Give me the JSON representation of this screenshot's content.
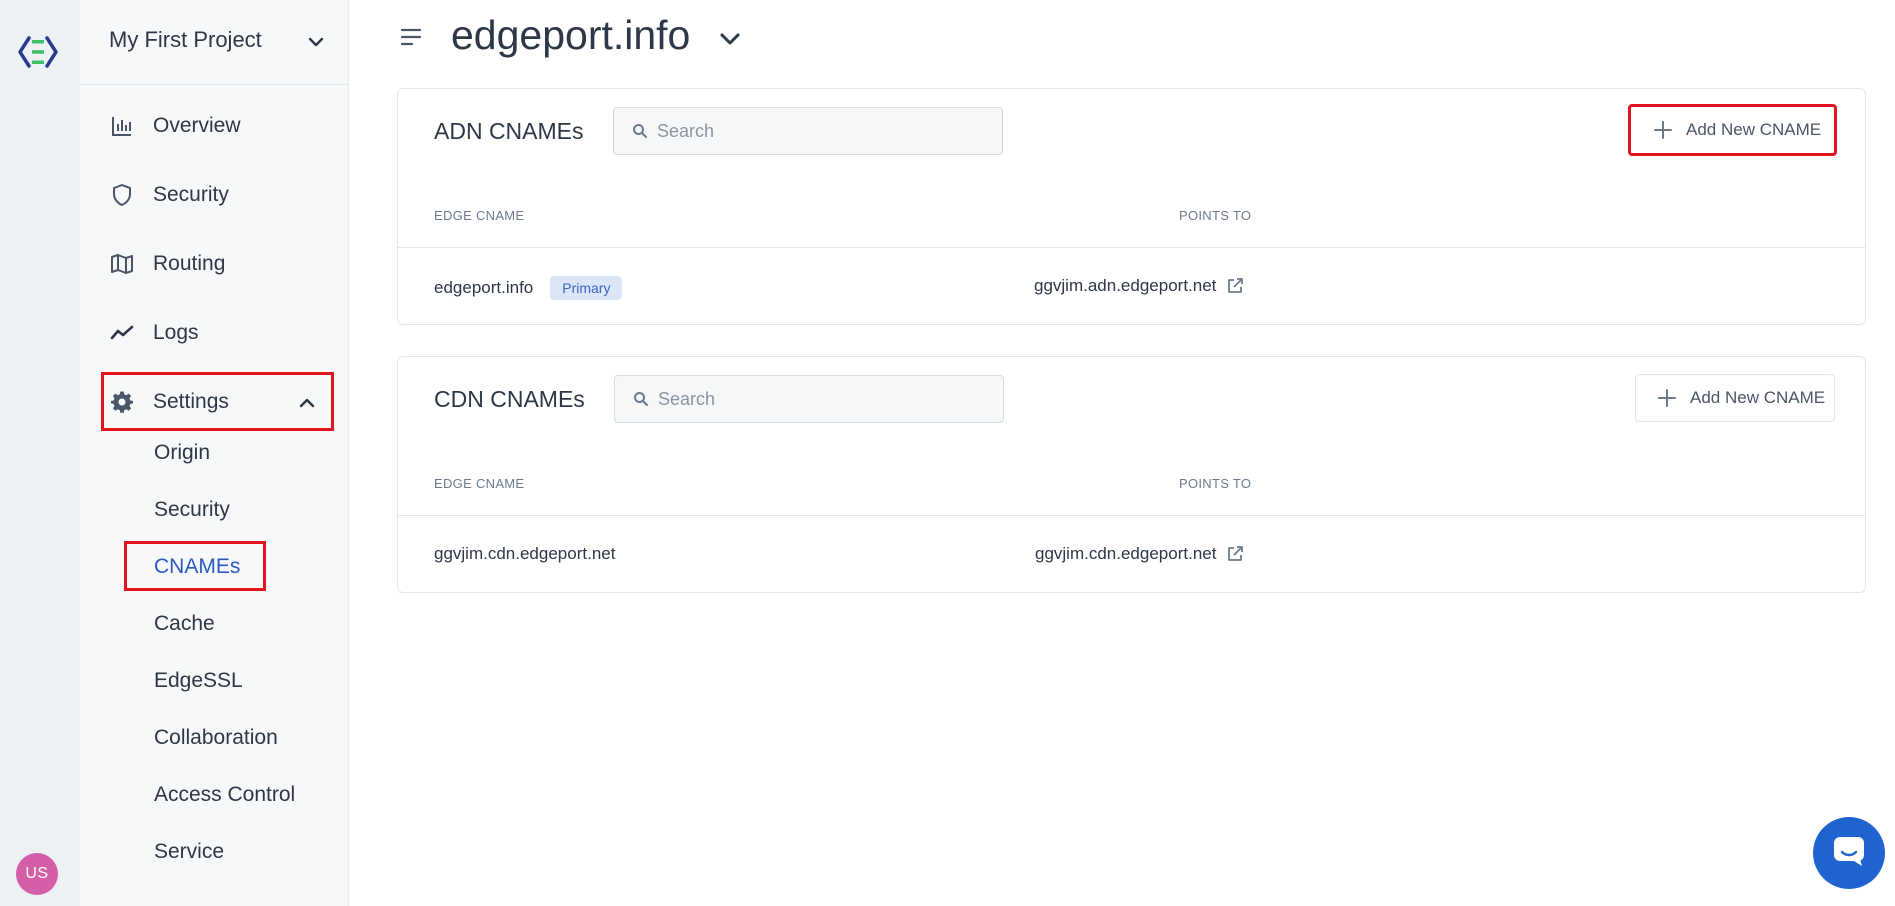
{
  "brand": {
    "logo_icon": "edgeport-logo-icon",
    "accent": "#2b59c3",
    "highlight": "#e3141f"
  },
  "user": {
    "initials": "US",
    "avatar_color": "#d45ea8"
  },
  "sidebar": {
    "project_name": "My First Project",
    "items": [
      {
        "label": "Overview",
        "icon": "bar-chart-icon"
      },
      {
        "label": "Security",
        "icon": "shield-icon"
      },
      {
        "label": "Routing",
        "icon": "map-icon"
      },
      {
        "label": "Logs",
        "icon": "trend-line-icon"
      },
      {
        "label": "Settings",
        "icon": "gear-icon"
      }
    ],
    "settings_sub": [
      "Origin",
      "Security",
      "CNAMEs",
      "Cache",
      "EdgeSSL",
      "Collaboration",
      "Access Control",
      "Service"
    ],
    "active_sub": "CNAMEs"
  },
  "header": {
    "title": "edgeport.info"
  },
  "adn": {
    "title": "ADN CNAMEs",
    "search_placeholder": "Search",
    "add_label": "Add New CNAME",
    "col_edge": "EDGE CNAME",
    "col_points": "POINTS TO",
    "row": {
      "edge": "edgeport.info",
      "badge": "Primary",
      "points_to": "ggvjim.adn.edgeport.net"
    }
  },
  "cdn": {
    "title": "CDN CNAMEs",
    "search_placeholder": "Search",
    "add_label": "Add New CNAME",
    "col_edge": "EDGE CNAME",
    "col_points": "POINTS TO",
    "row": {
      "edge": "ggvjim.cdn.edgeport.net",
      "points_to": "ggvjim.cdn.edgeport.net"
    }
  }
}
